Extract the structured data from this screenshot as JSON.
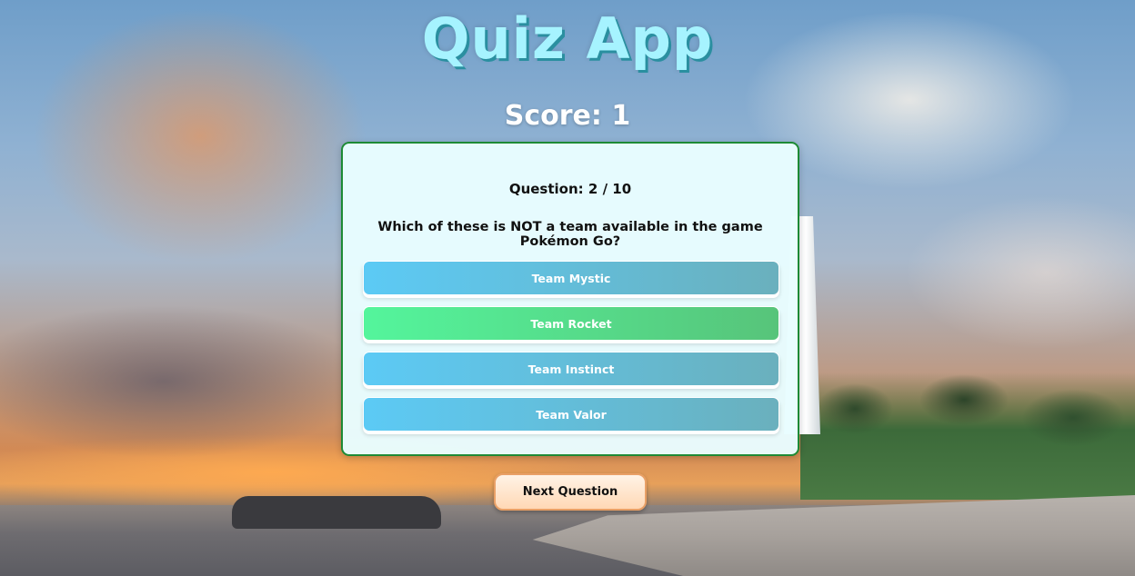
{
  "app": {
    "title": "Quiz App"
  },
  "score": {
    "label": "Score:",
    "value": "1"
  },
  "question": {
    "label": "Question:",
    "current": "2",
    "separator": "/",
    "total": "10",
    "text": "Which of these is NOT a team available in the game Pokémon Go?"
  },
  "answers": [
    {
      "label": "Team Mystic",
      "state": "default"
    },
    {
      "label": "Team Rocket",
      "state": "correct"
    },
    {
      "label": "Team Instinct",
      "state": "default"
    },
    {
      "label": "Team Valor",
      "state": "default"
    }
  ],
  "next_button": {
    "label": "Next Question"
  },
  "colors": {
    "title": "#a6f3ff",
    "card_border": "#1d8a35",
    "answer_default": "#5ccaf5",
    "answer_correct": "#54f59c",
    "next_button_border": "#e9a066"
  }
}
